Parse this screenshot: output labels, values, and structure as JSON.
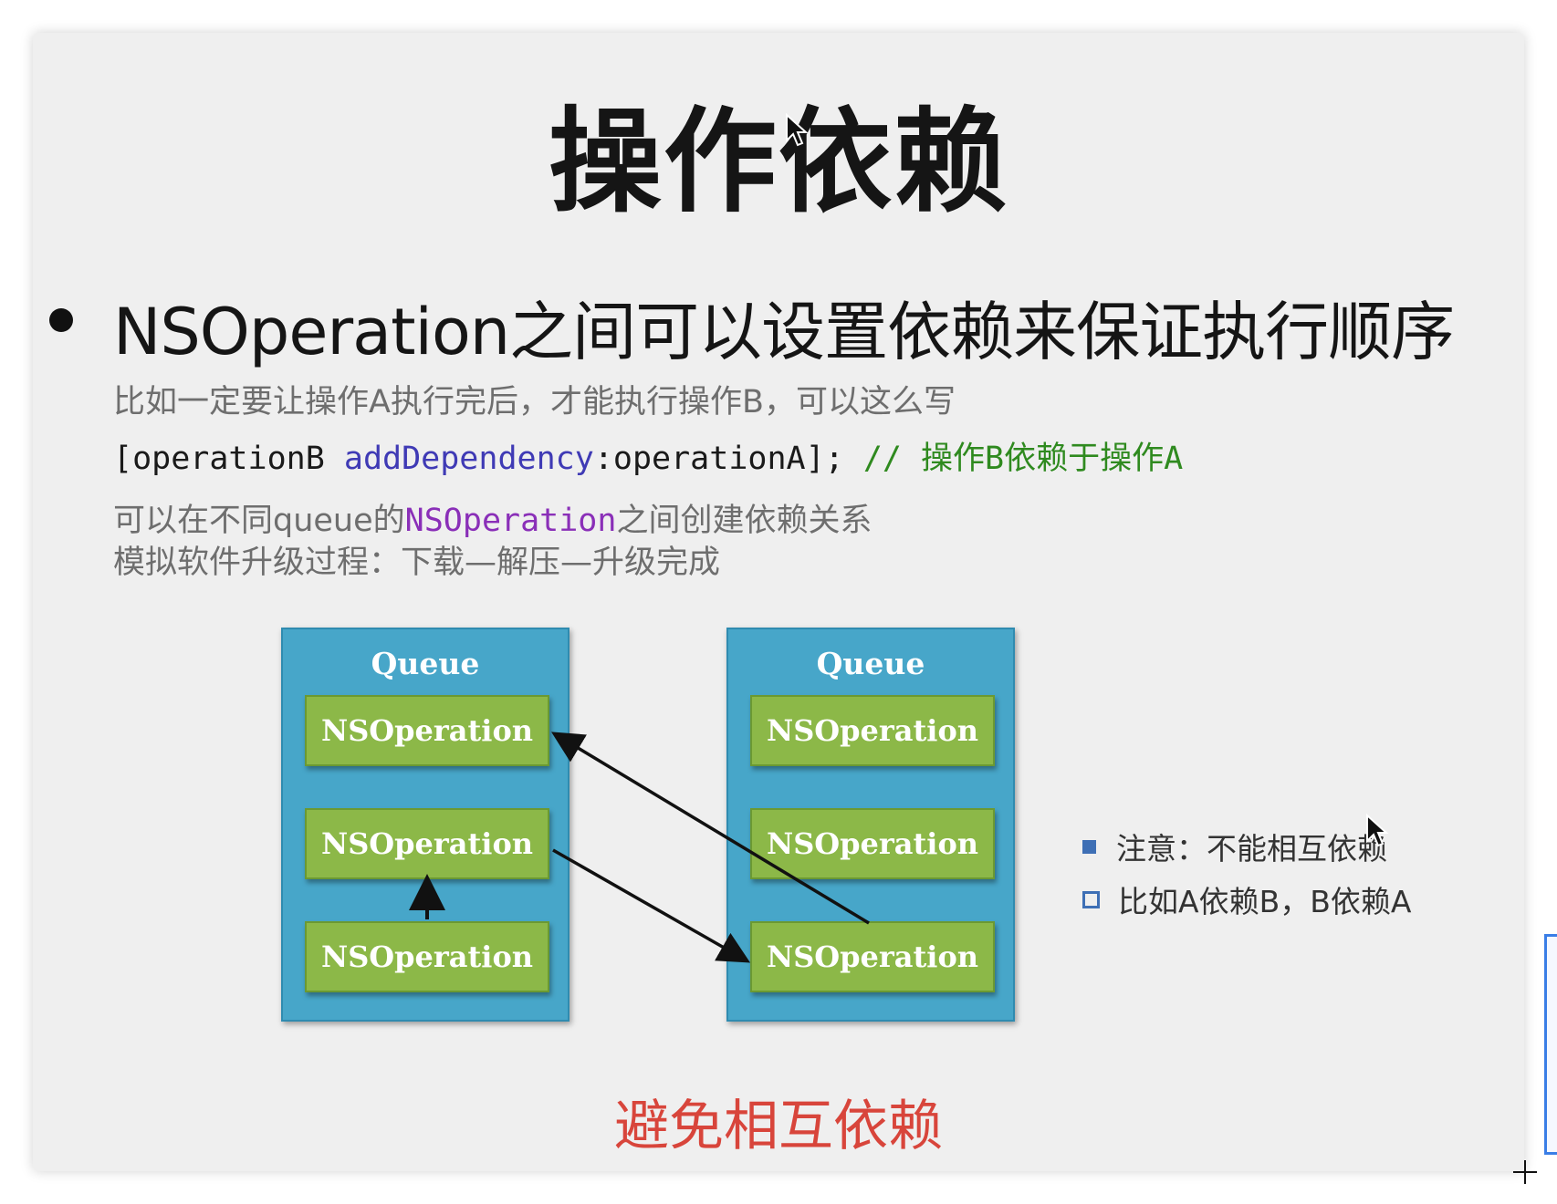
{
  "slide": {
    "title": "操作依赖",
    "bullet": "NSOperation之间可以设置依赖来保证执行顺序",
    "line1": "比如一定要让操作A执行完后，才能执行操作B，可以这么写",
    "code": {
      "part1": "[operationB ",
      "method": "addDependency",
      "part2": ":operationA]; ",
      "comment": "// 操作B依赖于操作A"
    },
    "line3": {
      "pre": "可以在不同queue的",
      "highlight": "NSOperation",
      "post": "之间创建依赖关系"
    },
    "line4": "模拟软件升级过程：下载—解压—升级完成",
    "diagram": {
      "queue_left": {
        "title": "Queue",
        "ops": [
          "NSOperation",
          "NSOperation",
          "NSOperation"
        ]
      },
      "queue_right": {
        "title": "Queue",
        "ops": [
          "NSOperation",
          "NSOperation",
          "NSOperation"
        ]
      }
    },
    "notes": [
      "注意：不能相互依赖",
      "比如A依赖B，B依赖A"
    ],
    "footer": "避免相互依赖"
  },
  "colors": {
    "queue_blue": "#47a6c9",
    "op_green": "#8cb848",
    "method_blue": "#3f3ab5",
    "comment_green": "#2f8a1f",
    "highlight_purple": "#8a2fb8",
    "warning_red": "#d8453b",
    "note_square": "#3e6fb5"
  },
  "icons": [
    "bullet-dot-icon",
    "mouse-pointer-icon",
    "crosshair-icon",
    "filled-square-icon",
    "open-square-icon"
  ]
}
